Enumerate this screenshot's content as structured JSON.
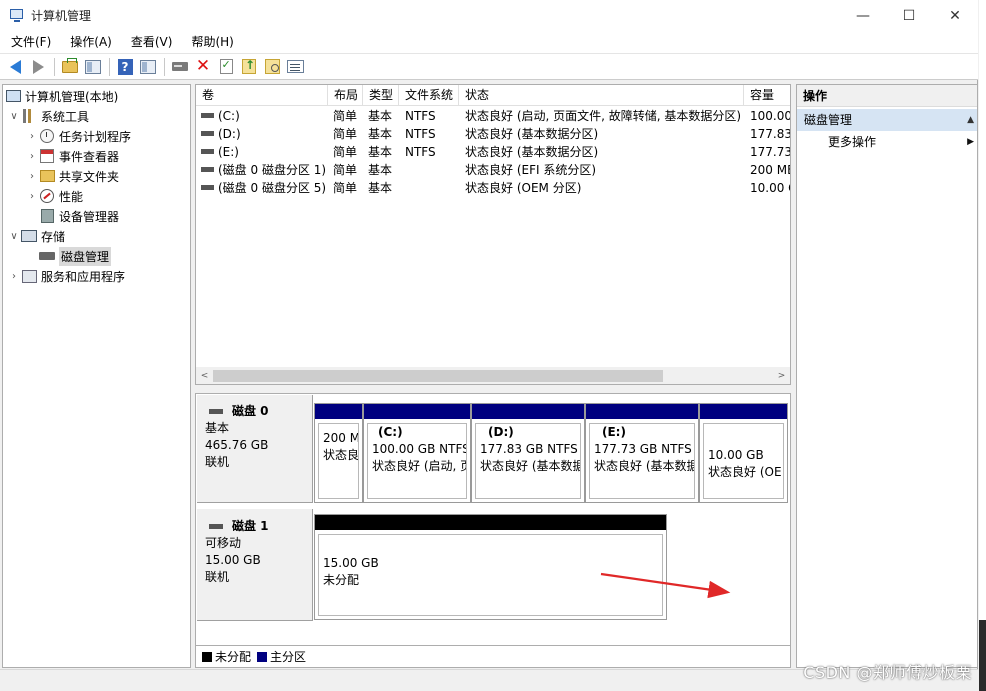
{
  "window": {
    "title": "计算机管理",
    "minimize": "—",
    "maximize": "☐",
    "close": "✕"
  },
  "menu": [
    "文件(F)",
    "操作(A)",
    "查看(V)",
    "帮助(H)"
  ],
  "toolbar": {
    "icons": [
      "back-arrow-icon",
      "forward-arrow-icon",
      "up-folder-icon",
      "show-tree-icon",
      "help-icon",
      "show-pane-icon",
      "connect-disk-icon",
      "delete-icon",
      "check-icon",
      "up-level-icon",
      "search-folder-icon",
      "properties-icon"
    ]
  },
  "tree": {
    "root": "计算机管理(本地)",
    "system_tools": "系统工具",
    "task_scheduler": "任务计划程序",
    "event_viewer": "事件查看器",
    "shared_folders": "共享文件夹",
    "performance": "性能",
    "device_manager": "设备管理器",
    "storage": "存储",
    "disk_management": "磁盘管理",
    "services": "服务和应用程序",
    "expand_open": "∨",
    "expand_closed": "›"
  },
  "volume_list": {
    "columns": [
      "卷",
      "布局",
      "类型",
      "文件系统",
      "状态",
      "容量"
    ],
    "rows": [
      {
        "vol": "(C:)",
        "layout": "简单",
        "type": "基本",
        "fs": "NTFS",
        "status": "状态良好 (启动, 页面文件, 故障转储, 基本数据分区)",
        "cap": "100.00"
      },
      {
        "vol": "(D:)",
        "layout": "简单",
        "type": "基本",
        "fs": "NTFS",
        "status": "状态良好 (基本数据分区)",
        "cap": "177.83"
      },
      {
        "vol": "(E:)",
        "layout": "简单",
        "type": "基本",
        "fs": "NTFS",
        "status": "状态良好 (基本数据分区)",
        "cap": "177.73"
      },
      {
        "vol": "(磁盘 0 磁盘分区 1)",
        "layout": "简单",
        "type": "基本",
        "fs": "",
        "status": "状态良好 (EFI 系统分区)",
        "cap": "200 ME"
      },
      {
        "vol": "(磁盘 0 磁盘分区 5)",
        "layout": "简单",
        "type": "基本",
        "fs": "",
        "status": "状态良好 (OEM 分区)",
        "cap": "10.00 G"
      }
    ],
    "scroll_left": "<",
    "scroll_right": ">"
  },
  "disks": [
    {
      "name": "磁盘 0",
      "kind": "基本",
      "size": "465.76 GB",
      "state": "联机",
      "partitions": [
        {
          "name": "",
          "size": "200 M",
          "status": "状态良"
        },
        {
          "name": "(C:)",
          "size": "100.00 GB NTFS",
          "status": "状态良好 (启动, 页"
        },
        {
          "name": "(D:)",
          "size": "177.83 GB NTFS",
          "status": "状态良好 (基本数据"
        },
        {
          "name": "(E:)",
          "size": "177.73 GB NTFS",
          "status": "状态良好 (基本数据"
        },
        {
          "name": "",
          "size": "10.00 GB",
          "status": "状态良好 (OE"
        }
      ]
    },
    {
      "name": "磁盘 1",
      "kind": "可移动",
      "size": "15.00 GB",
      "state": "联机",
      "partitions": [
        {
          "name": "",
          "size": "15.00 GB",
          "status": "未分配"
        }
      ]
    }
  ],
  "legend": [
    {
      "label": "未分配",
      "color": "#000000"
    },
    {
      "label": "主分区",
      "color": "#000080"
    }
  ],
  "actions": {
    "header": "操作",
    "section": "磁盘管理",
    "section_caret": "▲",
    "more": "更多操作",
    "more_caret": "▶"
  },
  "colors": {
    "primary_partition": "#000080",
    "unallocated": "#000000",
    "annotation_arrow": "#e02828",
    "selection": "#d6e4f3"
  },
  "watermark": "CSDN @郑师傅炒板栗"
}
